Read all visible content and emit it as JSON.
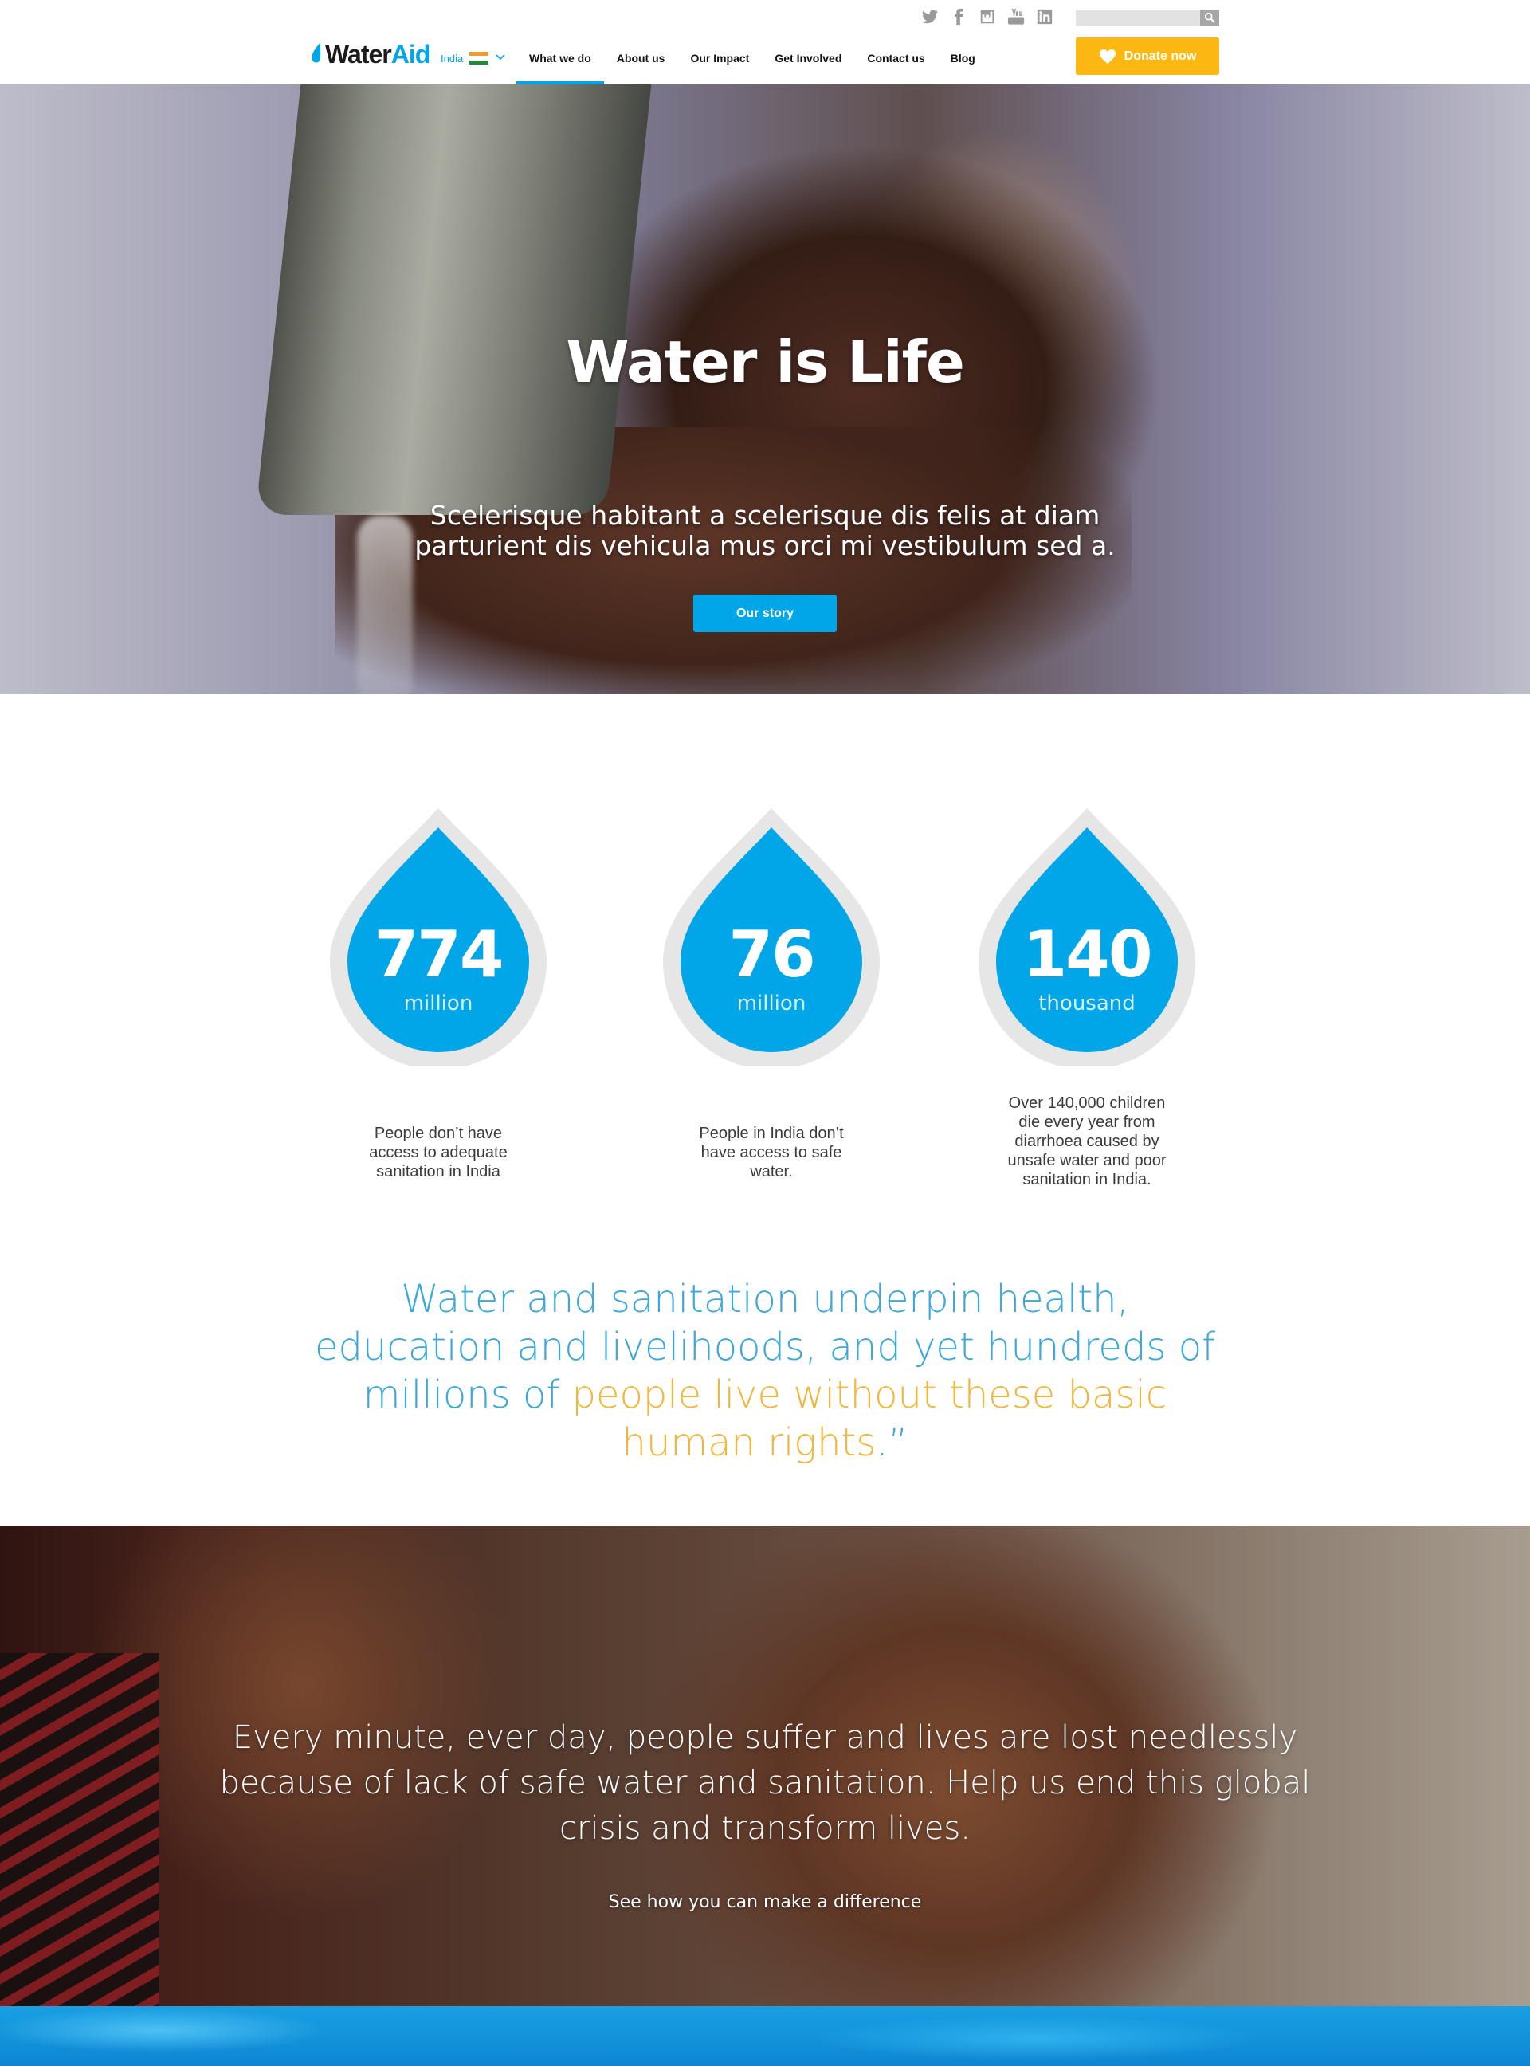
{
  "header": {
    "logo_water": "Water",
    "logo_aid": "Aid",
    "country": "India",
    "search_placeholder": "",
    "nav": [
      "What we do",
      "About us",
      "Our Impact",
      "Get Involved",
      "Contact us",
      "Blog"
    ],
    "active_nav": "What we do",
    "donate_label": "Donate now",
    "social_icons": [
      "twitter-icon",
      "facebook-icon",
      "instagram-icon",
      "youtube-icon",
      "linkedin-icon"
    ]
  },
  "hero": {
    "title": "Water is Life",
    "subtitle": "Scelerisque habitant a scelerisque dis felis at diam parturient dis vehicula mus orci mi vestibulum sed a.",
    "button_label": "Our story"
  },
  "stats": [
    {
      "value": "774",
      "unit": "million",
      "description": "People don’t have access to adequate sanitation in India"
    },
    {
      "value": "76",
      "unit": "million",
      "description": "People in India don’t have access to safe water."
    },
    {
      "value": "140",
      "unit": "thousand",
      "description": "Over 140,000 children die every year from diarrhoea caused by unsafe water and poor sanitation in India."
    }
  ],
  "quote": {
    "part1": "Water and sanitation underpin health, education and livelihoods, and yet hundreds of millions of ",
    "highlight": "people live without these basic human rights",
    "part2": ".”"
  },
  "banner": {
    "text": "Every minute, ever day, people suffer and lives are lost needlessly because of lack of safe water and sanitation. Help us end this global crisis and transform lives.",
    "link_label": "See how you can make a difference"
  },
  "colors": {
    "brand_blue": "#00a6e8",
    "donate_yellow": "#fcb713",
    "quote_blue": "#3aa8db",
    "quote_highlight": "#f0b73a"
  }
}
